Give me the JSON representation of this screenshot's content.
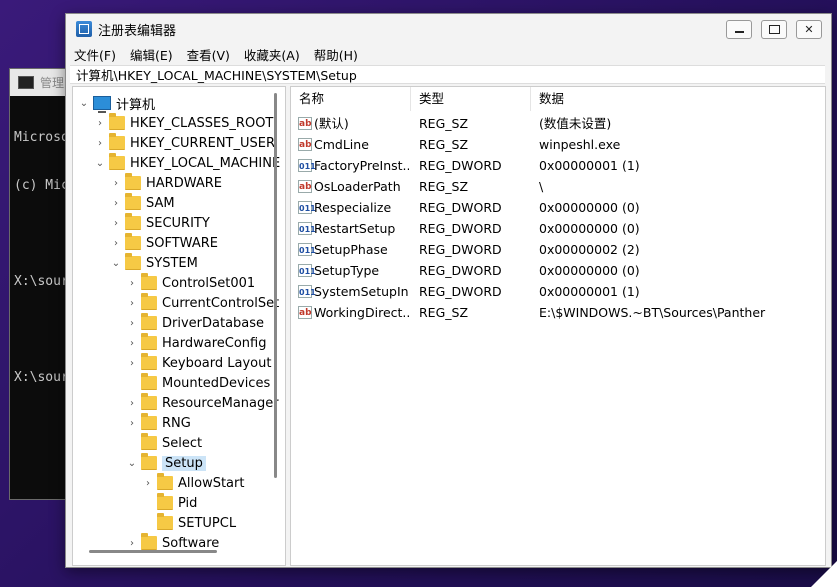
{
  "console": {
    "title": "管理员",
    "lines": [
      "Microso",
      "(c) Mic",
      "",
      "X:\\sour",
      "",
      "X:\\sour"
    ]
  },
  "window": {
    "title": "注册表编辑器",
    "menu": [
      "文件(F)",
      "编辑(E)",
      "查看(V)",
      "收藏夹(A)",
      "帮助(H)"
    ],
    "address": "计算机\\HKEY_LOCAL_MACHINE\\SYSTEM\\Setup"
  },
  "tree": [
    {
      "label": "计算机",
      "level": 0,
      "chevron": "open",
      "icon": "computer-icon"
    },
    {
      "label": "HKEY_CLASSES_ROOT",
      "level": 1,
      "chevron": "closed",
      "icon": "folder-icon"
    },
    {
      "label": "HKEY_CURRENT_USER",
      "level": 1,
      "chevron": "closed",
      "icon": "folder-icon"
    },
    {
      "label": "HKEY_LOCAL_MACHINE",
      "level": 1,
      "chevron": "open",
      "icon": "folder-icon"
    },
    {
      "label": "HARDWARE",
      "level": 2,
      "chevron": "closed",
      "icon": "folder-icon"
    },
    {
      "label": "SAM",
      "level": 2,
      "chevron": "closed",
      "icon": "folder-icon"
    },
    {
      "label": "SECURITY",
      "level": 2,
      "chevron": "closed",
      "icon": "folder-icon"
    },
    {
      "label": "SOFTWARE",
      "level": 2,
      "chevron": "closed",
      "icon": "folder-icon"
    },
    {
      "label": "SYSTEM",
      "level": 2,
      "chevron": "open",
      "icon": "folder-icon"
    },
    {
      "label": "ControlSet001",
      "level": 3,
      "chevron": "closed",
      "icon": "folder-icon"
    },
    {
      "label": "CurrentControlSet",
      "level": 3,
      "chevron": "closed",
      "icon": "folder-icon"
    },
    {
      "label": "DriverDatabase",
      "level": 3,
      "chevron": "closed",
      "icon": "folder-icon"
    },
    {
      "label": "HardwareConfig",
      "level": 3,
      "chevron": "closed",
      "icon": "folder-icon"
    },
    {
      "label": "Keyboard Layout",
      "level": 3,
      "chevron": "closed",
      "icon": "folder-icon"
    },
    {
      "label": "MountedDevices",
      "level": 3,
      "chevron": "none",
      "icon": "folder-icon"
    },
    {
      "label": "ResourceManager",
      "level": 3,
      "chevron": "closed",
      "icon": "folder-icon"
    },
    {
      "label": "RNG",
      "level": 3,
      "chevron": "closed",
      "icon": "folder-icon"
    },
    {
      "label": "Select",
      "level": 3,
      "chevron": "none",
      "icon": "folder-icon"
    },
    {
      "label": "Setup",
      "level": 3,
      "chevron": "open",
      "icon": "folder-icon",
      "selected": true
    },
    {
      "label": "AllowStart",
      "level": 4,
      "chevron": "closed",
      "icon": "folder-icon"
    },
    {
      "label": "Pid",
      "level": 4,
      "chevron": "none",
      "icon": "folder-icon"
    },
    {
      "label": "SETUPCL",
      "level": 4,
      "chevron": "none",
      "icon": "folder-icon"
    },
    {
      "label": "Software",
      "level": 3,
      "chevron": "closed",
      "icon": "folder-icon"
    }
  ],
  "columns": [
    "名称",
    "类型",
    "数据"
  ],
  "values": [
    {
      "name": "(默认)",
      "type": "REG_SZ",
      "data": "(数值未设置)",
      "icon": "string-value-icon"
    },
    {
      "name": "CmdLine",
      "type": "REG_SZ",
      "data": "winpeshl.exe",
      "icon": "string-value-icon"
    },
    {
      "name": "FactoryPreInst...",
      "type": "REG_DWORD",
      "data": "0x00000001 (1)",
      "icon": "binary-value-icon"
    },
    {
      "name": "OsLoaderPath",
      "type": "REG_SZ",
      "data": "\\",
      "icon": "string-value-icon"
    },
    {
      "name": "Respecialize",
      "type": "REG_DWORD",
      "data": "0x00000000 (0)",
      "icon": "binary-value-icon"
    },
    {
      "name": "RestartSetup",
      "type": "REG_DWORD",
      "data": "0x00000000 (0)",
      "icon": "binary-value-icon"
    },
    {
      "name": "SetupPhase",
      "type": "REG_DWORD",
      "data": "0x00000002 (2)",
      "icon": "binary-value-icon"
    },
    {
      "name": "SetupType",
      "type": "REG_DWORD",
      "data": "0x00000000 (0)",
      "icon": "binary-value-icon"
    },
    {
      "name": "SystemSetupIn...",
      "type": "REG_DWORD",
      "data": "0x00000001 (1)",
      "icon": "binary-value-icon"
    },
    {
      "name": "WorkingDirect...",
      "type": "REG_SZ",
      "data": "E:\\$WINDOWS.~BT\\Sources\\Panther",
      "icon": "string-value-icon"
    }
  ],
  "icons": {
    "string": "ab",
    "binary": "011"
  },
  "colors": {
    "selection": "#cce4f7",
    "folder": "#f6c945",
    "desktop": "#2a1466"
  }
}
